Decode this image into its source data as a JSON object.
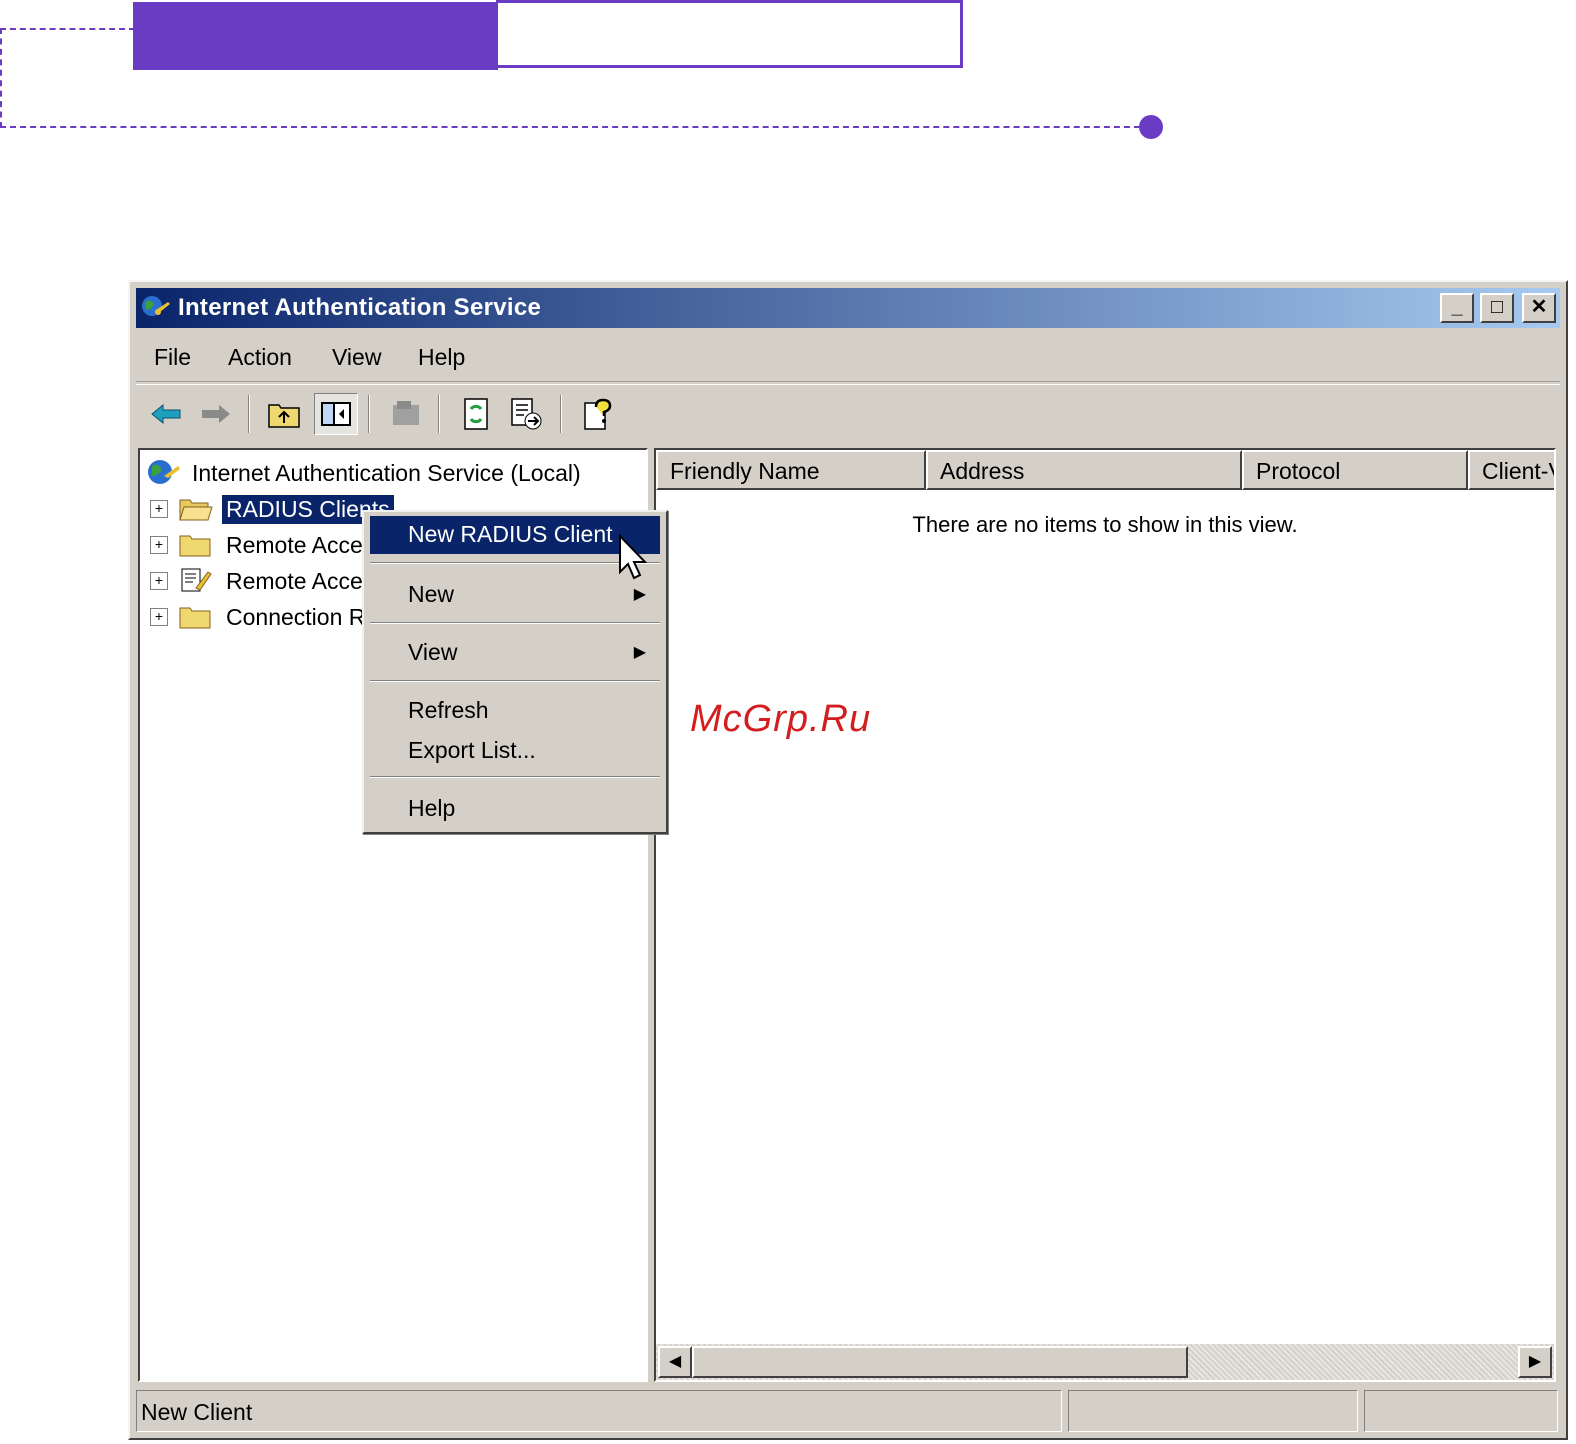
{
  "window": {
    "title": "Internet Authentication Service",
    "controls": {
      "minimize": "_",
      "maximize": "□",
      "close": "✕"
    }
  },
  "menubar": {
    "items": [
      {
        "label": "File",
        "underline": "F"
      },
      {
        "label": "Action",
        "underline": "A"
      },
      {
        "label": "View",
        "underline": "V"
      },
      {
        "label": "Help",
        "underline": "H"
      }
    ]
  },
  "toolbar": {
    "icons": [
      "back-arrow-icon",
      "forward-arrow-icon",
      "up-folder-icon",
      "show-hide-tree-icon",
      "delete-icon",
      "refresh-icon",
      "export-list-icon",
      "help-icon"
    ]
  },
  "tree": {
    "root": "Internet Authentication Service (Local)",
    "items": [
      {
        "label": "RADIUS Clients",
        "selected": true
      },
      {
        "label": "Remote Acce"
      },
      {
        "label": "Remote Acce"
      },
      {
        "label": "Connection R"
      }
    ]
  },
  "list": {
    "columns": [
      "Friendly Name",
      "Address",
      "Protocol",
      "Client-V"
    ],
    "empty_message": "There are no items to show in this view."
  },
  "context_menu": {
    "items": [
      {
        "label": "New RADIUS Client",
        "highlighted": true
      },
      {
        "label": "New",
        "submenu": true
      },
      {
        "label": "View",
        "submenu": true
      },
      {
        "label": "Refresh"
      },
      {
        "label": "Export List..."
      },
      {
        "label": "Help"
      }
    ]
  },
  "status_bar": {
    "text": "New Client"
  },
  "watermark": "McGrp.Ru",
  "colors": {
    "accent": "#6a3cc4",
    "title_start": "#0a246a",
    "title_end": "#a6caf0",
    "selection": "#0a246a"
  }
}
